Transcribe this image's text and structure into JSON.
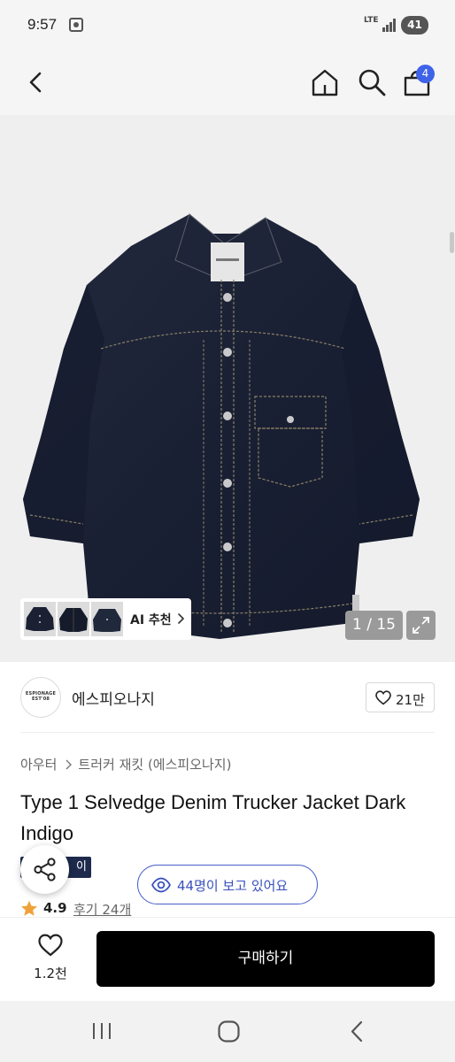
{
  "status_bar": {
    "time": "9:57",
    "network": "LTE",
    "battery": "41"
  },
  "header": {
    "cart_badge": "4",
    "icons": [
      "back-icon",
      "home-icon",
      "search-icon",
      "cart-icon"
    ]
  },
  "gallery": {
    "thumbnails_label": "AI 추천",
    "page_counter": "1 / 15",
    "thumbnail_count": 3
  },
  "brand": {
    "logo_text_line1": "ESPIONAGE",
    "logo_text_line2": "EST'08",
    "name": "에스피오나지",
    "likes": "21만"
  },
  "breadcrumb": {
    "category": "아우터",
    "subcategory": "트러커 재킷 (에스피오나지)"
  },
  "product": {
    "title": "Type 1 Selvedge Denim Trucker Jacket Dark Indigo",
    "tag_partial": "이",
    "viewers": "44명이 보고 있어요",
    "rating": "4.9",
    "reviews": "후기 24개"
  },
  "bottom_bar": {
    "wish_count": "1.2천",
    "buy_label": "구매하기"
  },
  "colors": {
    "accent_blue": "#3f63e8",
    "viewers_blue": "#3850bd",
    "tag_navy": "#1d2a4c",
    "star_orange": "#f0a23a",
    "buy_black": "#000000"
  }
}
